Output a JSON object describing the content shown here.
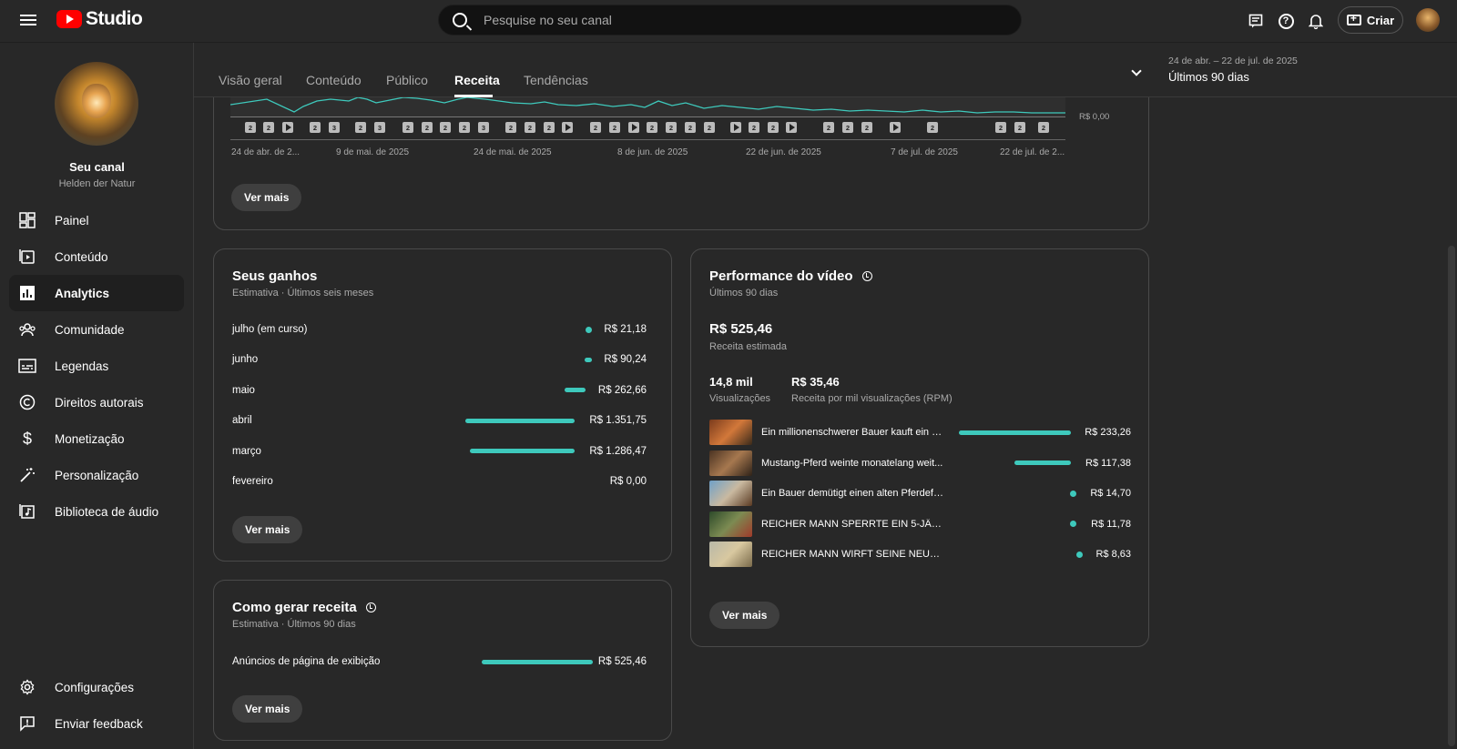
{
  "header": {
    "logo_text": "Studio",
    "search_placeholder": "Pesquise no seu canal",
    "create_label": "Criar"
  },
  "sidebar": {
    "channel_name": "Seu canal",
    "channel_handle": "Helden der Natur",
    "items": [
      {
        "label": "Painel",
        "icon": "dashboard-icon"
      },
      {
        "label": "Conteúdo",
        "icon": "content-icon"
      },
      {
        "label": "Analytics",
        "icon": "analytics-icon"
      },
      {
        "label": "Comunidade",
        "icon": "community-icon"
      },
      {
        "label": "Legendas",
        "icon": "subtitles-icon"
      },
      {
        "label": "Direitos autorais",
        "icon": "copyright-icon"
      },
      {
        "label": "Monetização",
        "icon": "monetization-icon"
      },
      {
        "label": "Personalização",
        "icon": "customization-icon"
      },
      {
        "label": "Biblioteca de áudio",
        "icon": "audio-library-icon"
      }
    ],
    "bottom_items": [
      {
        "label": "Configurações",
        "icon": "settings-icon"
      },
      {
        "label": "Enviar feedback",
        "icon": "feedback-icon"
      }
    ]
  },
  "tabs": [
    "Visão geral",
    "Conteúdo",
    "Público",
    "Receita",
    "Tendências"
  ],
  "active_tab": "Receita",
  "date_range": {
    "range": "24 de abr. – 22 de jul. de 2025",
    "label": "Últimos 90 dias"
  },
  "revenue_chart": {
    "y_label": "R$ 0,00",
    "x_ticks": [
      "24 de abr. de 2...",
      "9 de mai. de 2025",
      "24 de mai. de 2025",
      "8 de jun. de 2025",
      "22 de jun. de 2025",
      "7 de jul. de 2025",
      "22 de jul. de 2..."
    ],
    "markers": [
      "2",
      "2",
      "play",
      "2",
      "3",
      "2",
      "3",
      "2",
      "2",
      "2",
      "2",
      "3",
      "2",
      "2",
      "2",
      "play",
      "2",
      "2",
      "play",
      "2",
      "2",
      "2",
      "2",
      "play",
      "2",
      "2",
      "play",
      "2",
      "2",
      "2",
      "play",
      "2",
      "2",
      "2",
      "2"
    ],
    "more_label": "Ver mais"
  },
  "earnings": {
    "title": "Seus ganhos",
    "subtitle": "Estimativa · Últimos seis meses",
    "rows": [
      {
        "label": "julho (em curso)",
        "value": "R$ 21,18",
        "amount": 21.18
      },
      {
        "label": "junho",
        "value": "R$ 90,24",
        "amount": 90.24
      },
      {
        "label": "maio",
        "value": "R$ 262,66",
        "amount": 262.66
      },
      {
        "label": "abril",
        "value": "R$ 1.351,75",
        "amount": 1351.75
      },
      {
        "label": "março",
        "value": "R$ 1.286,47",
        "amount": 1286.47
      },
      {
        "label": "fevereiro",
        "value": "R$ 0,00",
        "amount": 0
      }
    ],
    "more_label": "Ver mais"
  },
  "how_to_earn": {
    "title": "Como gerar receita",
    "subtitle": "Estimativa · Últimos 90 dias",
    "rows": [
      {
        "label": "Anúncios de página de exibição",
        "value": "R$ 525,46"
      }
    ],
    "more_label": "Ver mais"
  },
  "video_performance": {
    "title": "Performance do vídeo",
    "subtitle": "Últimos 90 dias",
    "revenue_value": "R$ 525,46",
    "revenue_label": "Receita estimada",
    "views_value": "14,8 mil",
    "views_label": "Visualizações",
    "rpm_value": "R$ 35,46",
    "rpm_label": "Receita por mil visualizações (RPM)",
    "videos": [
      {
        "title": "Ein millionenschwerer Bauer kauft ein a...",
        "value": "R$ 233,26",
        "amount": 233.26
      },
      {
        "title": "Mustang-Pferd weinte monatelang weit...",
        "value": "R$ 117,38",
        "amount": 117.38
      },
      {
        "title": "Ein Bauer demütigt einen alten Pferdefl...",
        "value": "R$ 14,70",
        "amount": 14.7
      },
      {
        "title": "REICHER MANN SPERRTE EIN 5-JÄHRI...",
        "value": "R$ 11,78",
        "amount": 11.78
      },
      {
        "title": "REICHER MANN WIRFT SEINE NEUGEB...",
        "value": "R$ 8,63",
        "amount": 8.63
      }
    ],
    "more_label": "Ver mais"
  },
  "colors": {
    "accent_teal": "#3ec9bc",
    "background": "#282828",
    "youtube_red": "#ff0000"
  }
}
